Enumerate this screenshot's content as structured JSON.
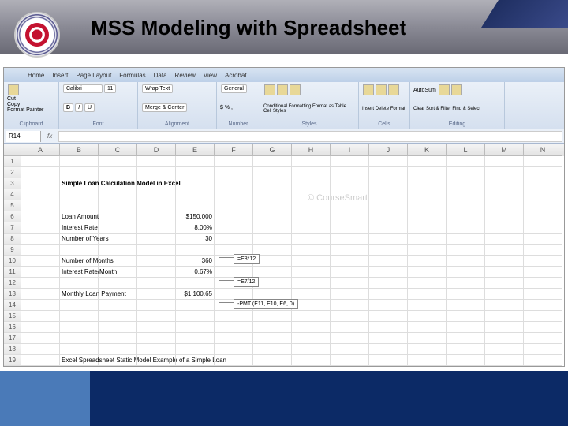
{
  "slide": {
    "title": "MSS Modeling with Spreadsheet"
  },
  "ribbon": {
    "tabs": [
      "Home",
      "Insert",
      "Page Layout",
      "Formulas",
      "Data",
      "Review",
      "View",
      "Acrobat"
    ],
    "clipboard": {
      "cut": "Cut",
      "copy": "Copy",
      "fmt": "Format Painter",
      "name": "Clipboard"
    },
    "font": {
      "face": "Calibri",
      "size": "11",
      "name": "Font"
    },
    "align": {
      "wrap": "Wrap Text",
      "merge": "Merge & Center",
      "name": "Alignment"
    },
    "number": {
      "fmt": "General",
      "sym": "$ % ,",
      "name": "Number"
    },
    "styles": {
      "cf": "Conditional Formatting",
      "tbl": "Format as Table",
      "cs": "Cell Styles",
      "name": "Styles"
    },
    "cells": {
      "ins": "Insert",
      "del": "Delete",
      "fmt": "Format",
      "name": "Cells"
    },
    "editing": {
      "sum": "AutoSum",
      "fill": "Fill",
      "clear": "Clear",
      "sort": "Sort & Filter",
      "find": "Find & Select",
      "name": "Editing"
    }
  },
  "fbar": {
    "cellref": "R14",
    "fx": "fx"
  },
  "cols": [
    "A",
    "B",
    "C",
    "D",
    "E",
    "F",
    "G",
    "H",
    "I",
    "J",
    "K",
    "L",
    "M",
    "N"
  ],
  "sheet": {
    "title": "Simple Loan Calculation Model in Excel",
    "r6l": "Loan Amount",
    "r6v": "$150,000",
    "r7l": "Interest Rate",
    "r7v": "8.00%",
    "r8l": "Number of Years",
    "r8v": "30",
    "r10l": "Number of Months",
    "r10v": "360",
    "r11l": "Interest Rate/Month",
    "r11v": "0.67%",
    "r13l": "Monthly Loan Payment",
    "r13v": "$1,100.65",
    "caption": "Excel Spreadsheet Static Model Example of a Simple Loan"
  },
  "callouts": {
    "c1": "=E8*12",
    "c2": "=E7/12",
    "c3": "-PMT (E11, E10, E6, 0)"
  },
  "watermark": "© CourseSmart",
  "chart_data": {
    "type": "table",
    "title": "Simple Loan Calculation Model in Excel",
    "rows": [
      {
        "label": "Loan Amount",
        "value": 150000,
        "display": "$150,000"
      },
      {
        "label": "Interest Rate",
        "value": 0.08,
        "display": "8.00%"
      },
      {
        "label": "Number of Years",
        "value": 30,
        "display": "30"
      },
      {
        "label": "Number of Months",
        "value": 360,
        "display": "360",
        "formula": "=E8*12"
      },
      {
        "label": "Interest Rate/Month",
        "value": 0.0067,
        "display": "0.67%",
        "formula": "=E7/12"
      },
      {
        "label": "Monthly Loan Payment",
        "value": 1100.65,
        "display": "$1,100.65",
        "formula": "-PMT(E11,E10,E6,0)"
      }
    ]
  }
}
